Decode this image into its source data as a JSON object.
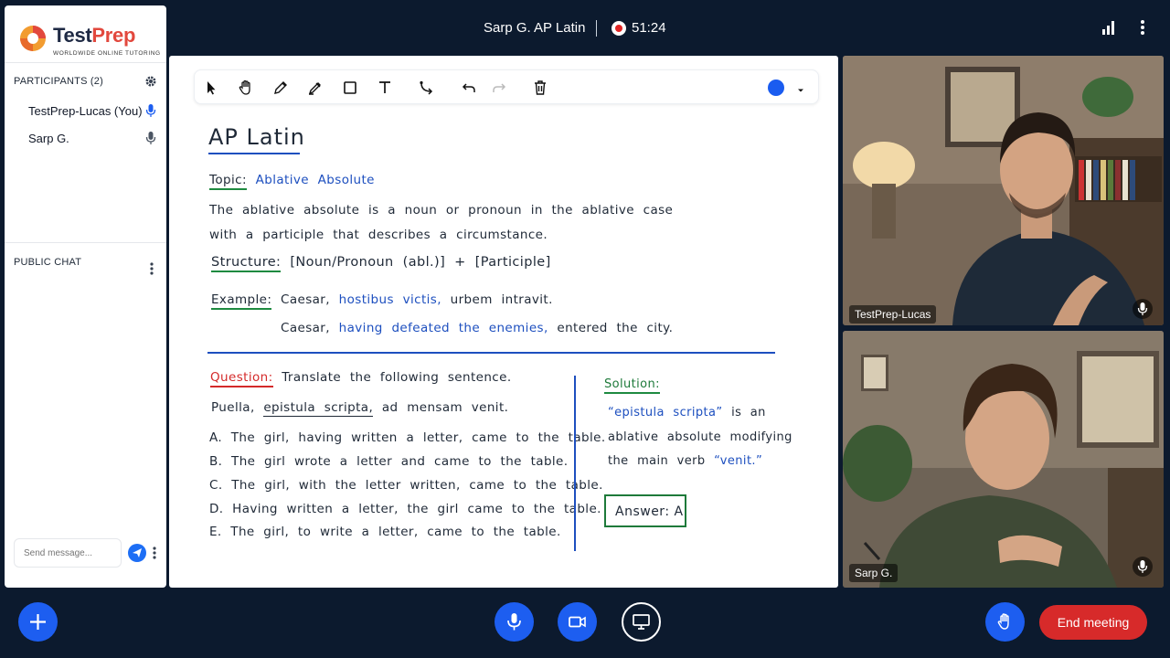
{
  "header": {
    "meeting_title": "Sarp G. AP Latin",
    "timer": "51:24"
  },
  "sidebar": {
    "logo": {
      "brand_a": "Test",
      "brand_b": "Prep",
      "tagline": "WORLDWIDE ONLINE TUTORING"
    },
    "participants_title": "PARTICIPANTS (2)",
    "participants": [
      {
        "name": "TestPrep-Lucas (You)",
        "mic": "active"
      },
      {
        "name": "Sarp G.",
        "mic": "idle"
      }
    ],
    "chat_title": "PUBLIC CHAT",
    "chat_placeholder": "Send message..."
  },
  "whiteboard": {
    "toolbar": {
      "tools": [
        "select-icon",
        "hand-icon",
        "pencil-icon",
        "highlighter-icon",
        "rectangle-icon",
        "text-icon",
        "connector-icon",
        "undo-icon",
        "redo-icon",
        "trash-icon"
      ],
      "color": "#1a5cf0"
    },
    "title": "AP Latin",
    "topic_label": "Topic:",
    "topic_value": "Ablative Absolute",
    "definition_line1": "The ablative absolute is a noun or pronoun in the ablative case",
    "definition_line2": "with a participle that describes a circumstance.",
    "structure_label": "Structure:",
    "structure_value": "[Noun/Pronoun (abl.)] + [Participle]",
    "example_label": "Example:",
    "example_latin_pre": "Caesar,",
    "example_latin_hl": "hostibus victis,",
    "example_latin_post": "urbem intravit.",
    "example_en_pre": "Caesar,",
    "example_en_hl": "having defeated the enemies,",
    "example_en_post": "entered the city.",
    "question_label": "Question:",
    "question_text": "Translate the following sentence.",
    "sentence_pre": "Puella,",
    "sentence_hl": "epistula scripta,",
    "sentence_post": "ad mensam venit.",
    "options": [
      "A. The girl, having written a letter, came to the table.",
      "B. The girl wrote a letter and came to the table.",
      "C. The girl, with the letter written, came to the table.",
      "D. Having written a letter, the girl came to the table.",
      "E. The girl, to write a letter, came to the table."
    ],
    "solution_label": "Solution:",
    "solution_line1_hl": "“epistula scripta”",
    "solution_line1_rest": "is an",
    "solution_line2": "ablative absolute modifying",
    "solution_line3_pre": "the main verb",
    "solution_line3_hl": "“venit.”",
    "answer": "Answer: A"
  },
  "videos": [
    {
      "name": "TestPrep-Lucas"
    },
    {
      "name": "Sarp G."
    }
  ],
  "controls": {
    "end_meeting": "End meeting"
  },
  "colors": {
    "background": "#0c1a2e",
    "accent_blue": "#1d5ef0",
    "end_red": "#d72a2a",
    "ink_blue": "#1d4fbf",
    "ink_green": "#1e7a3a",
    "ink_red": "#d42a2a"
  }
}
